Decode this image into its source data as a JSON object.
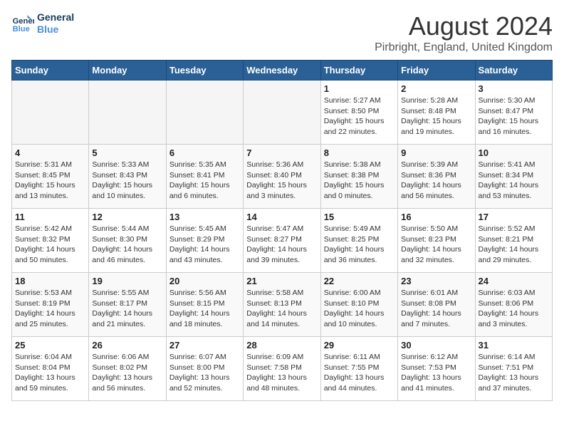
{
  "header": {
    "logo_line1": "General",
    "logo_line2": "Blue",
    "title": "August 2024",
    "subtitle": "Pirbright, England, United Kingdom"
  },
  "calendar": {
    "days_of_week": [
      "Sunday",
      "Monday",
      "Tuesday",
      "Wednesday",
      "Thursday",
      "Friday",
      "Saturday"
    ],
    "weeks": [
      [
        {
          "day": "",
          "info": ""
        },
        {
          "day": "",
          "info": ""
        },
        {
          "day": "",
          "info": ""
        },
        {
          "day": "",
          "info": ""
        },
        {
          "day": "1",
          "info": "Sunrise: 5:27 AM\nSunset: 8:50 PM\nDaylight: 15 hours\nand 22 minutes."
        },
        {
          "day": "2",
          "info": "Sunrise: 5:28 AM\nSunset: 8:48 PM\nDaylight: 15 hours\nand 19 minutes."
        },
        {
          "day": "3",
          "info": "Sunrise: 5:30 AM\nSunset: 8:47 PM\nDaylight: 15 hours\nand 16 minutes."
        }
      ],
      [
        {
          "day": "4",
          "info": "Sunrise: 5:31 AM\nSunset: 8:45 PM\nDaylight: 15 hours\nand 13 minutes."
        },
        {
          "day": "5",
          "info": "Sunrise: 5:33 AM\nSunset: 8:43 PM\nDaylight: 15 hours\nand 10 minutes."
        },
        {
          "day": "6",
          "info": "Sunrise: 5:35 AM\nSunset: 8:41 PM\nDaylight: 15 hours\nand 6 minutes."
        },
        {
          "day": "7",
          "info": "Sunrise: 5:36 AM\nSunset: 8:40 PM\nDaylight: 15 hours\nand 3 minutes."
        },
        {
          "day": "8",
          "info": "Sunrise: 5:38 AM\nSunset: 8:38 PM\nDaylight: 15 hours\nand 0 minutes."
        },
        {
          "day": "9",
          "info": "Sunrise: 5:39 AM\nSunset: 8:36 PM\nDaylight: 14 hours\nand 56 minutes."
        },
        {
          "day": "10",
          "info": "Sunrise: 5:41 AM\nSunset: 8:34 PM\nDaylight: 14 hours\nand 53 minutes."
        }
      ],
      [
        {
          "day": "11",
          "info": "Sunrise: 5:42 AM\nSunset: 8:32 PM\nDaylight: 14 hours\nand 50 minutes."
        },
        {
          "day": "12",
          "info": "Sunrise: 5:44 AM\nSunset: 8:30 PM\nDaylight: 14 hours\nand 46 minutes."
        },
        {
          "day": "13",
          "info": "Sunrise: 5:45 AM\nSunset: 8:29 PM\nDaylight: 14 hours\nand 43 minutes."
        },
        {
          "day": "14",
          "info": "Sunrise: 5:47 AM\nSunset: 8:27 PM\nDaylight: 14 hours\nand 39 minutes."
        },
        {
          "day": "15",
          "info": "Sunrise: 5:49 AM\nSunset: 8:25 PM\nDaylight: 14 hours\nand 36 minutes."
        },
        {
          "day": "16",
          "info": "Sunrise: 5:50 AM\nSunset: 8:23 PM\nDaylight: 14 hours\nand 32 minutes."
        },
        {
          "day": "17",
          "info": "Sunrise: 5:52 AM\nSunset: 8:21 PM\nDaylight: 14 hours\nand 29 minutes."
        }
      ],
      [
        {
          "day": "18",
          "info": "Sunrise: 5:53 AM\nSunset: 8:19 PM\nDaylight: 14 hours\nand 25 minutes."
        },
        {
          "day": "19",
          "info": "Sunrise: 5:55 AM\nSunset: 8:17 PM\nDaylight: 14 hours\nand 21 minutes."
        },
        {
          "day": "20",
          "info": "Sunrise: 5:56 AM\nSunset: 8:15 PM\nDaylight: 14 hours\nand 18 minutes."
        },
        {
          "day": "21",
          "info": "Sunrise: 5:58 AM\nSunset: 8:13 PM\nDaylight: 14 hours\nand 14 minutes."
        },
        {
          "day": "22",
          "info": "Sunrise: 6:00 AM\nSunset: 8:10 PM\nDaylight: 14 hours\nand 10 minutes."
        },
        {
          "day": "23",
          "info": "Sunrise: 6:01 AM\nSunset: 8:08 PM\nDaylight: 14 hours\nand 7 minutes."
        },
        {
          "day": "24",
          "info": "Sunrise: 6:03 AM\nSunset: 8:06 PM\nDaylight: 14 hours\nand 3 minutes."
        }
      ],
      [
        {
          "day": "25",
          "info": "Sunrise: 6:04 AM\nSunset: 8:04 PM\nDaylight: 13 hours\nand 59 minutes."
        },
        {
          "day": "26",
          "info": "Sunrise: 6:06 AM\nSunset: 8:02 PM\nDaylight: 13 hours\nand 56 minutes."
        },
        {
          "day": "27",
          "info": "Sunrise: 6:07 AM\nSunset: 8:00 PM\nDaylight: 13 hours\nand 52 minutes."
        },
        {
          "day": "28",
          "info": "Sunrise: 6:09 AM\nSunset: 7:58 PM\nDaylight: 13 hours\nand 48 minutes."
        },
        {
          "day": "29",
          "info": "Sunrise: 6:11 AM\nSunset: 7:55 PM\nDaylight: 13 hours\nand 44 minutes."
        },
        {
          "day": "30",
          "info": "Sunrise: 6:12 AM\nSunset: 7:53 PM\nDaylight: 13 hours\nand 41 minutes."
        },
        {
          "day": "31",
          "info": "Sunrise: 6:14 AM\nSunset: 7:51 PM\nDaylight: 13 hours\nand 37 minutes."
        }
      ]
    ]
  }
}
